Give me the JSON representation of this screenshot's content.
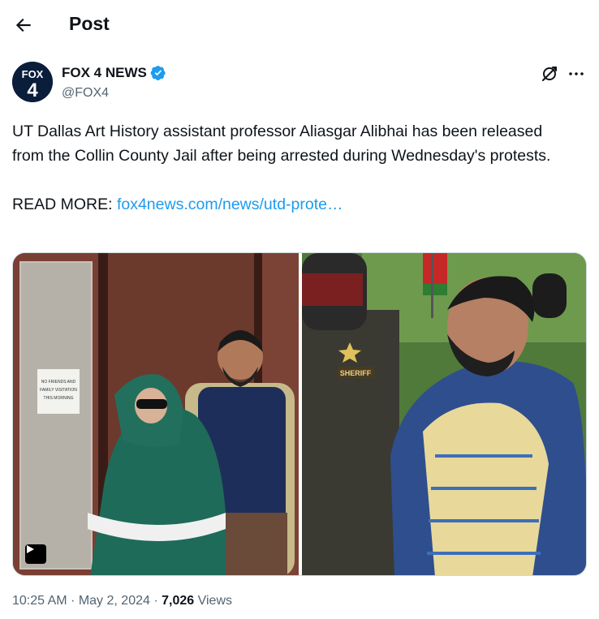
{
  "header": {
    "title": "Post"
  },
  "author": {
    "name": "FOX 4 NEWS",
    "handle": "@FOX4",
    "avatar_line1": "FOX",
    "avatar_line2": "4"
  },
  "tweet": {
    "text": "UT Dallas Art History assistant professor Aliasgar Alibhai has been released from the Collin County Jail after being arrested during Wednesday's protests.",
    "read_more_label": "READ MORE: ",
    "link_text": "fox4news.com/news/utd-prote…"
  },
  "media": {
    "sign_line1": "NO FRIENDS AND",
    "sign_line2": "FAMILY VISITATION",
    "sign_line3": "THIS MORNING",
    "badge_text": "SHERIFF"
  },
  "meta": {
    "time": "10:25 AM",
    "sep1": " · ",
    "date": "May 2, 2024",
    "sep2": " · ",
    "views_count": "7,026",
    "views_label": " Views"
  },
  "colors": {
    "accent": "#1d9bf0",
    "muted": "#536471",
    "text": "#0f1419"
  }
}
